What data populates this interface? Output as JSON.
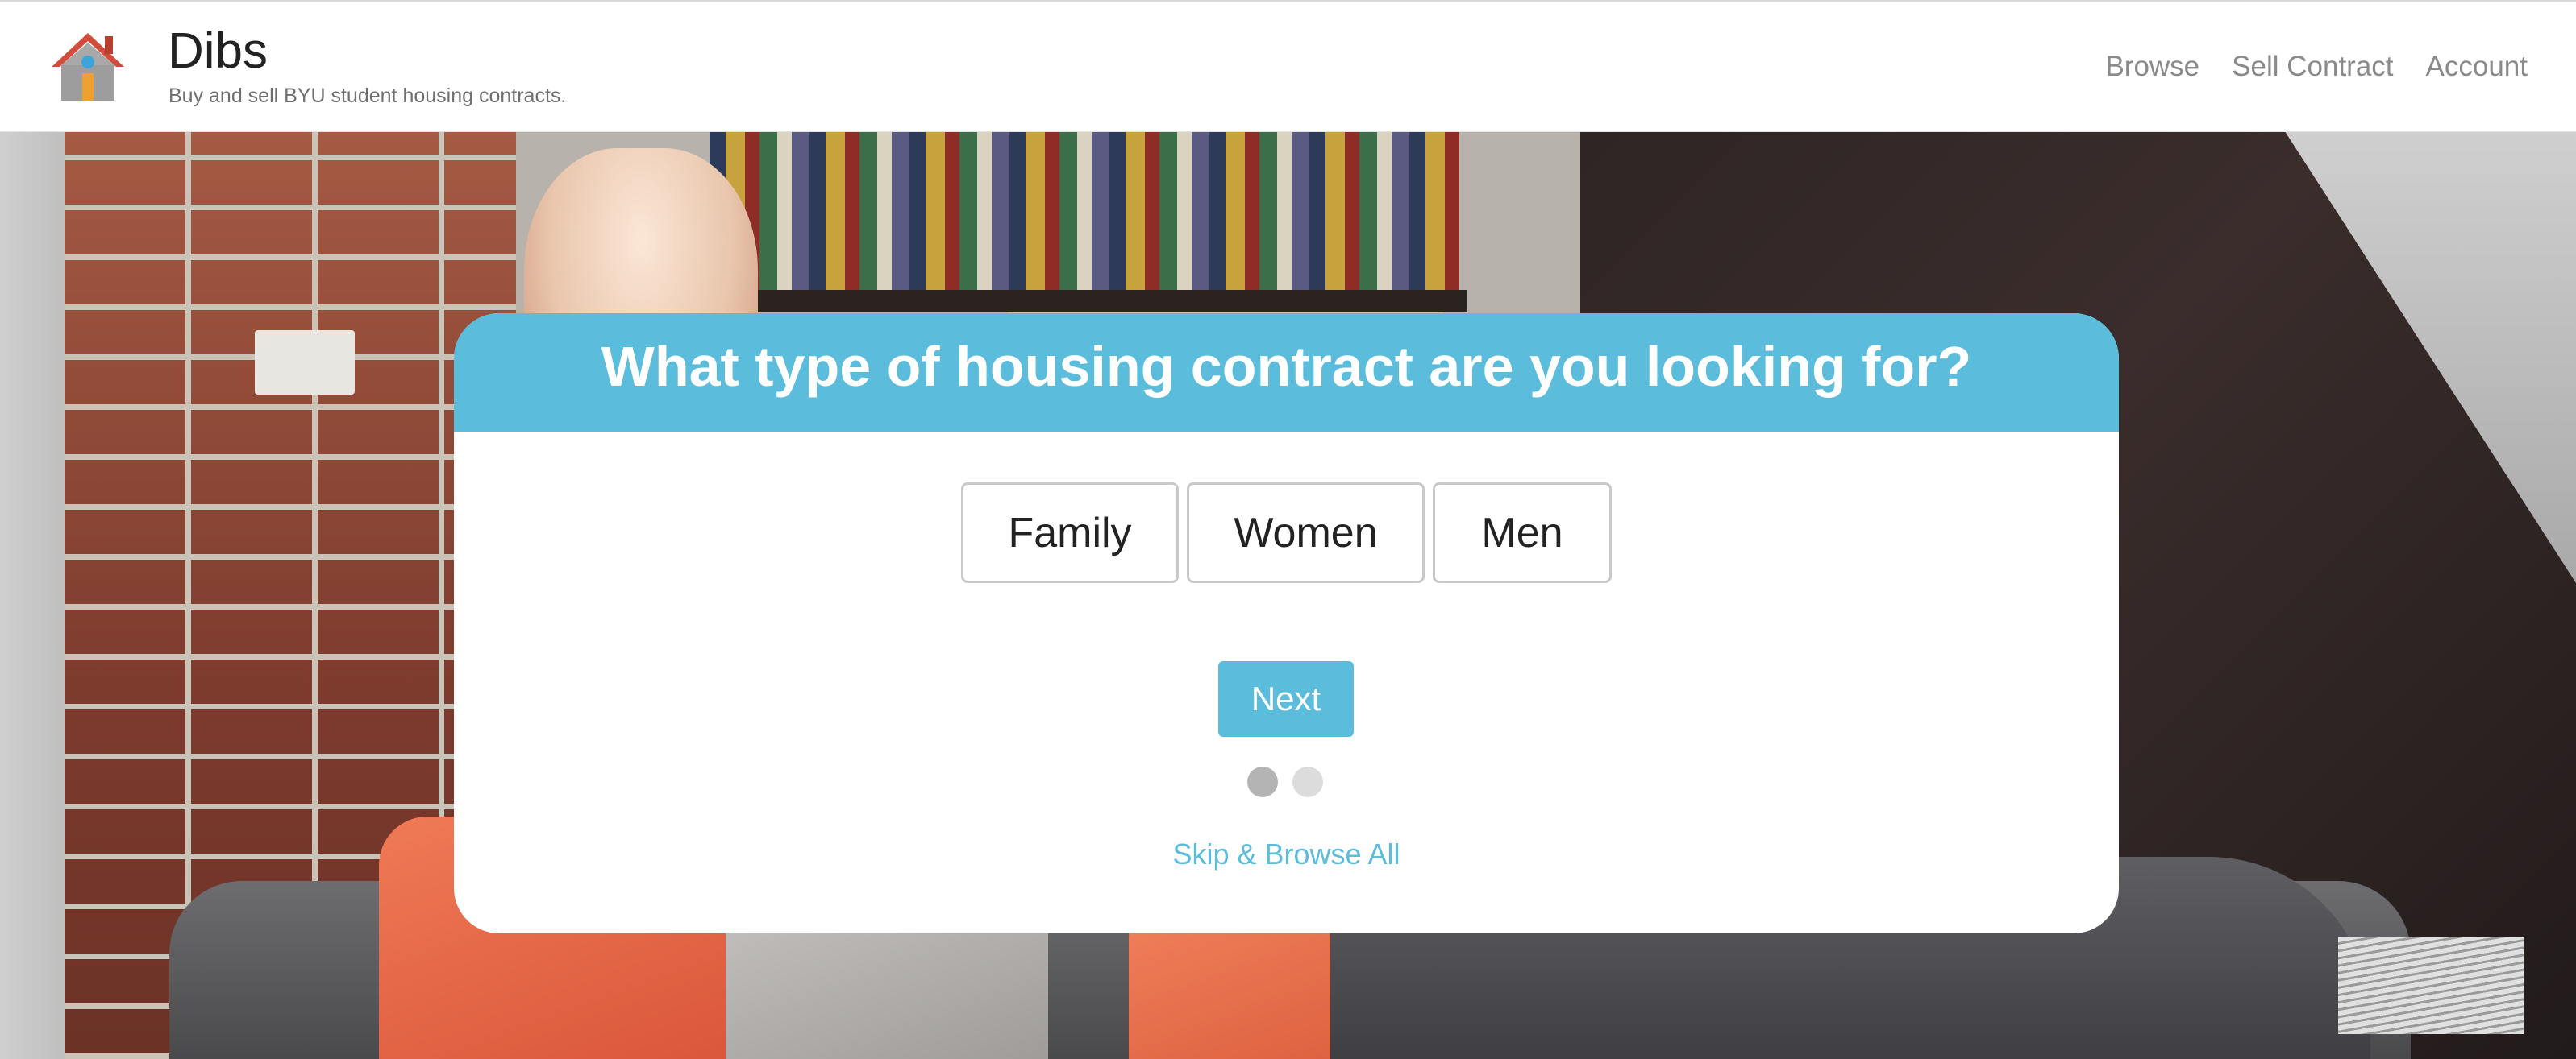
{
  "brand": {
    "title": "Dibs",
    "tagline": "Buy and sell BYU student housing contracts.",
    "logo_icon": "house-icon"
  },
  "nav": {
    "items": [
      {
        "label": "Browse"
      },
      {
        "label": "Sell Contract"
      },
      {
        "label": "Account"
      }
    ]
  },
  "card": {
    "title": "What type of housing contract are you looking for?",
    "options": [
      {
        "label": "Family"
      },
      {
        "label": "Women"
      },
      {
        "label": "Men"
      }
    ],
    "next_label": "Next",
    "step": {
      "current": 1,
      "total": 2
    },
    "skip_label": "Skip & Browse All"
  },
  "colors": {
    "accent": "#5bbcdc",
    "nav_text": "#8a8a8a",
    "title_text": "#222222",
    "dot_active": "#b4b4b4",
    "dot_inactive": "#dcdcdc"
  }
}
